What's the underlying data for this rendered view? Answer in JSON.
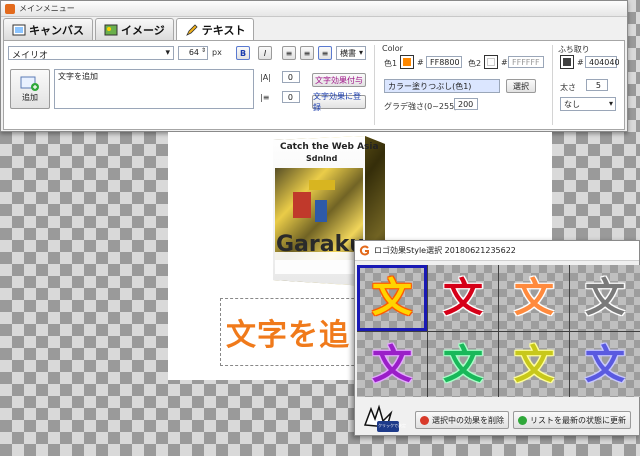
{
  "window": {
    "title": "メインメニュー"
  },
  "tabs": [
    {
      "label": "キャンバス"
    },
    {
      "label": "イメージ"
    },
    {
      "label": "テキスト"
    }
  ],
  "text_panel": {
    "font_name": "メイリオ",
    "font_size": "64",
    "font_unit": "px",
    "bold": "B",
    "italic": "I",
    "orientation": "横書",
    "add_label": "追加",
    "text_value": "文字を追加",
    "spacing_value": "0",
    "line_value": "0",
    "effect_button": "文字効果付与",
    "register_button": "文字効果に登録"
  },
  "color_panel": {
    "heading": "Color",
    "color1_label": "色1",
    "color1_value": "FF8800",
    "color1_hex": "#ff8800",
    "color2_label": "色2",
    "color2_value": "FFFFFF",
    "color2_hex": "#ffffff",
    "preset_label": "カラー塗りつぶし(色1)",
    "select_button": "選択",
    "gradient_label": "グラデ強さ(0~255)",
    "gradient_value": "200"
  },
  "outline_panel": {
    "heading": "ふち取り",
    "color_value": "404040",
    "color_hex": "#404040",
    "size_label": "太さ",
    "size_value": "5",
    "style_value": "なし"
  },
  "canvas": {
    "product_heading": "Catch the Web Asia",
    "product_subheading": "Sdnlnd",
    "product_name": "Garaku",
    "text_content": "文字を追"
  },
  "style_window": {
    "title": "ロゴ効果Style選択 20180621235622",
    "glyph": "文",
    "styles": [
      {
        "fill": "#ffd400",
        "stroke": "#ff5a00"
      },
      {
        "fill": "#d60018",
        "stroke": "#ffffff"
      },
      {
        "fill": "#ff8a3d",
        "stroke": "#ffffff"
      },
      {
        "fill": "#7a7a7a",
        "stroke": "#ffffff"
      },
      {
        "fill": "#9a1fc8",
        "stroke": "#e4a8ff"
      },
      {
        "fill": "#19b85a",
        "stroke": "#a9ffc8"
      },
      {
        "fill": "#c8c81a",
        "stroke": "#ffff9a"
      },
      {
        "fill": "#5a5ae0",
        "stroke": "#c8c8ff"
      }
    ],
    "mascot_label": "クリックで決定",
    "delete_button": "選択中の効果を削除",
    "refresh_button": "リストを最新の状態に更新"
  }
}
